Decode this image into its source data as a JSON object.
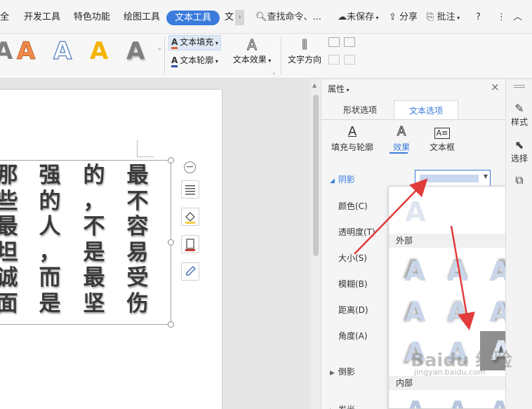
{
  "menubar": {
    "items": [
      "全",
      "开发工具",
      "特色功能",
      "绘图工具"
    ],
    "active": "文本工具",
    "clipped": "文",
    "search": "查找命令、...",
    "unsaved": "未保存",
    "share": "分享",
    "comment": "批注",
    "help": "?",
    "more": "⋮",
    "collapse": "︿"
  },
  "ribbon": {
    "fill_label": "文本填充",
    "outline_label": "文本轮廓",
    "effect_label": "文本效果",
    "direction_label": "文字方向",
    "style_colors": [
      "#f08a4b",
      "#ffffff",
      "#f4b400",
      "#7f7f7f"
    ]
  },
  "document": {
    "columns": [
      [
        "最",
        "不",
        "容",
        "易",
        "受",
        "伤"
      ],
      [
        "的",
        "，",
        "不",
        "是",
        "最",
        "坚"
      ],
      [
        "强",
        "的",
        "人",
        "，",
        "而",
        "是"
      ],
      [
        "那",
        "些",
        "最",
        "坦",
        "诚",
        "面"
      ]
    ]
  },
  "panel": {
    "title": "属性",
    "tab_shape": "形状选项",
    "tab_text": "文本选项",
    "sub_fill": "填充与轮廓",
    "sub_effect": "效果",
    "sub_textbox": "文本框",
    "section_shadow": "阴影",
    "labels": [
      "颜色(C)",
      "透明度(T)",
      "大小(S)",
      "模糊(B)",
      "距离(D)",
      "角度(A)"
    ],
    "section_reflection": "倒影",
    "section_glow": "发光"
  },
  "gallery": {
    "header_outer": "外部",
    "header_inner": "内部"
  },
  "sidebar": {
    "style": "样式",
    "select": "选择"
  },
  "watermark": {
    "main": "Baidu 经验",
    "sub": "jingyan.baidu.com"
  },
  "colors": {
    "accent": "#3a7bdc",
    "arrow": "#e23b3b"
  }
}
